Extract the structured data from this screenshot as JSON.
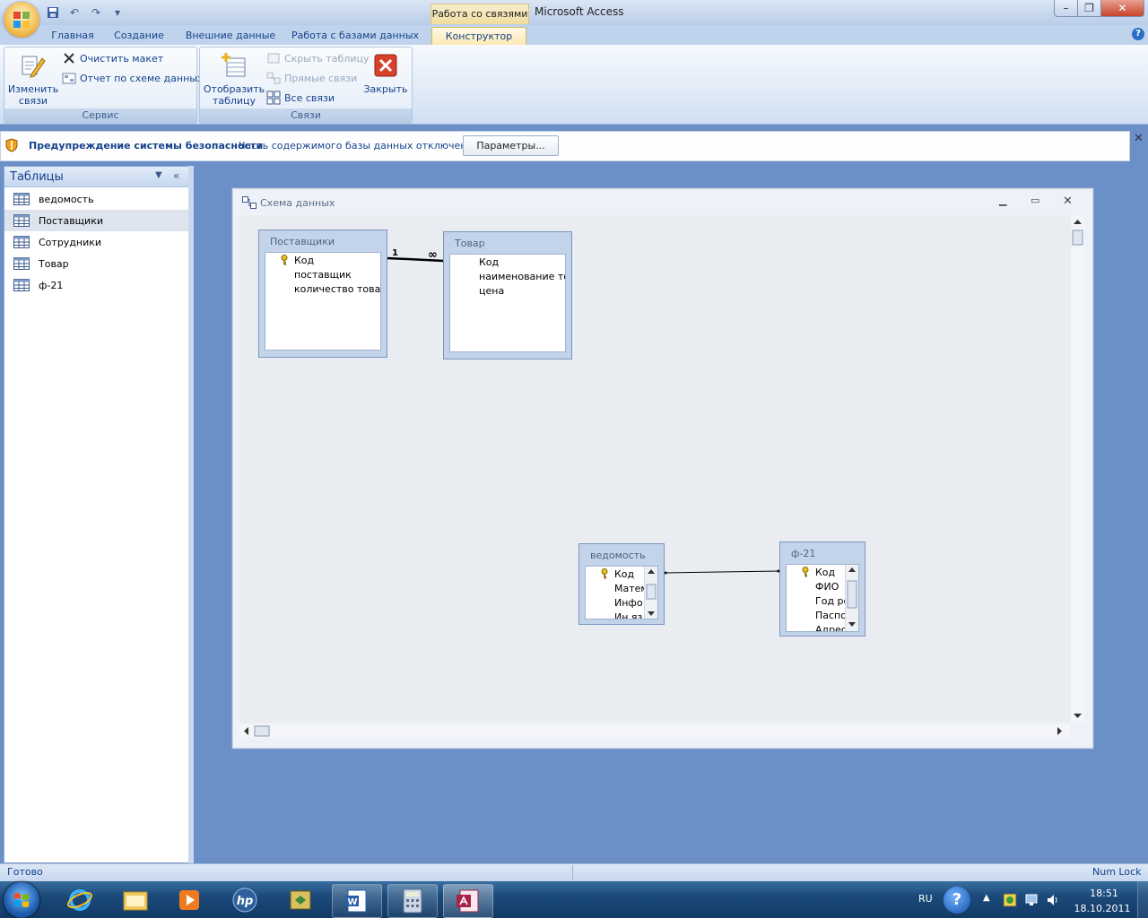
{
  "titlebar": {
    "context_tab": "Работа со связями",
    "app_title": "Microsoft Access"
  },
  "ribbon_tabs": [
    "Главная",
    "Создание",
    "Внешние данные",
    "Работа с базами данных",
    "Конструктор"
  ],
  "ribbon": {
    "service": {
      "label": "Сервис",
      "edit_relations": "Изменить\nсвязи",
      "clear_layout": "Очистить макет",
      "schema_report": "Отчет по схеме данных"
    },
    "relations": {
      "label": "Связи",
      "show_table": "Отобразить\nтаблицу",
      "hide_table": "Скрыть таблицу",
      "direct_relations": "Прямые связи",
      "all_relations": "Все связи",
      "close": "Закрыть"
    }
  },
  "security": {
    "title": "Предупреждение системы безопасности",
    "message": "Часть содержимого базы данных отключено",
    "params_button": "Параметры..."
  },
  "nav": {
    "title": "Таблицы",
    "items": [
      "ведомость",
      "Поставщики",
      "Сотрудники",
      "Товар",
      "ф-21"
    ],
    "selected_index": 1
  },
  "schema_window": {
    "title": "Схема данных",
    "tables": {
      "suppliers": {
        "title": "Поставщики",
        "fields": [
          "Код",
          "поставщик",
          "количество товар"
        ]
      },
      "goods": {
        "title": "Товар",
        "fields": [
          "Код",
          "наименование то",
          "цена"
        ]
      },
      "vedomost": {
        "title": "ведомость",
        "fields": [
          "Код",
          "Матем",
          "Инфо",
          "Ин.яз"
        ]
      },
      "f21": {
        "title": "ф-21",
        "fields": [
          "Код",
          "ФИО",
          "Год ро",
          "Паспо",
          "Адрес"
        ]
      }
    },
    "relation_labels": {
      "one": "1",
      "many": "∞"
    }
  },
  "statusbar": {
    "status": "Готово",
    "numlock": "Num Lock"
  },
  "taskbar": {
    "lang": "RU",
    "time": "18:51",
    "date": "18.10.2011"
  },
  "colors": {
    "workspace": "#6b8fc7",
    "ribbon_text": "#15428b",
    "taskbar": "#1b4a7a"
  }
}
